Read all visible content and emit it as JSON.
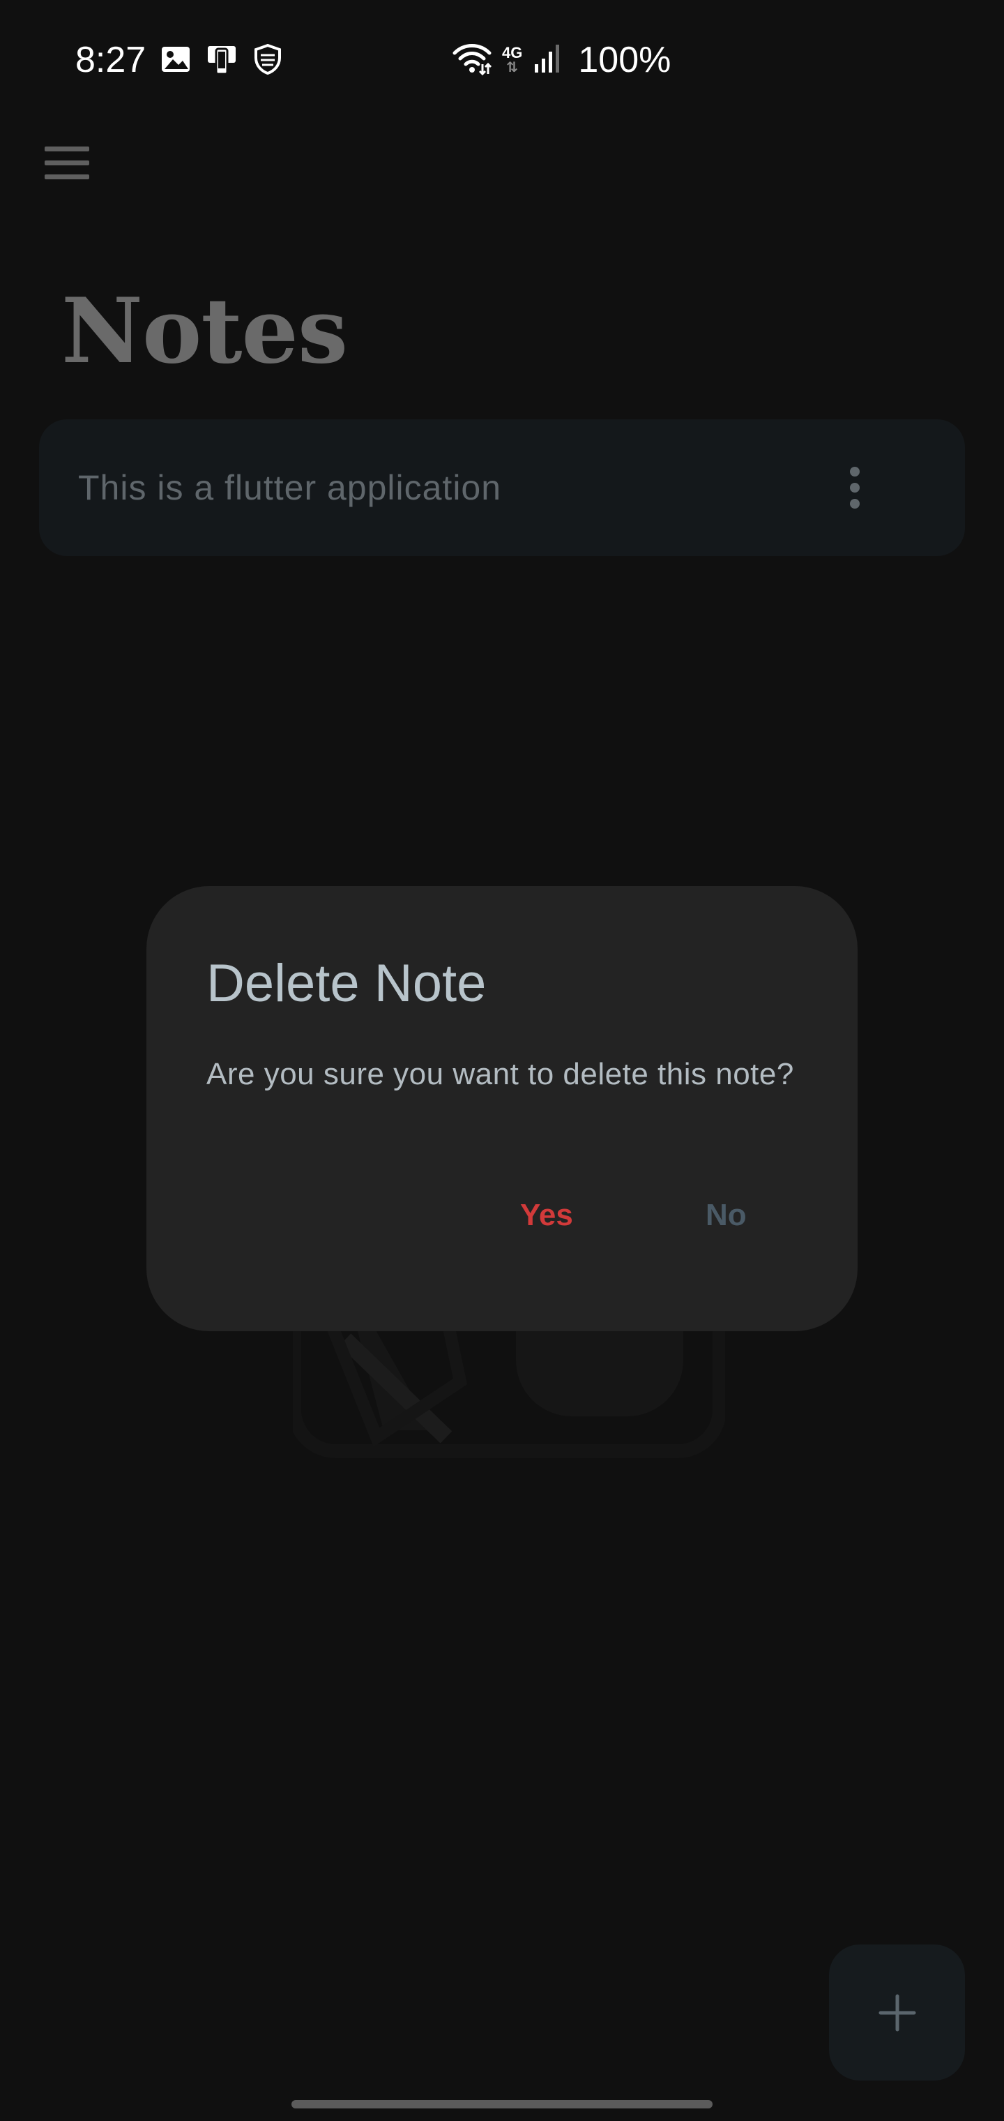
{
  "status_bar": {
    "time": "8:27",
    "battery": "100%",
    "network_label": "4G",
    "icons": [
      "image-icon",
      "device-icon",
      "shield-icon",
      "wifi-icon",
      "signal-icon"
    ]
  },
  "app": {
    "title": "Notes",
    "menu_icon": "hamburger-menu-icon",
    "notes": [
      {
        "text": "This is a flutter application"
      }
    ],
    "fab_icon": "plus-icon"
  },
  "dialog": {
    "title": "Delete Note",
    "message": "Are you sure you want to delete this note?",
    "yes_label": "Yes",
    "no_label": "No"
  },
  "colors": {
    "background": "#101010",
    "dialog_bg": "#232323",
    "yes": "#d23a3a",
    "no": "#4a5a66",
    "card": "#14181b"
  }
}
